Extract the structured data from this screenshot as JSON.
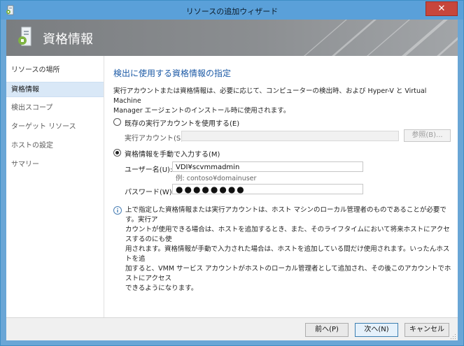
{
  "window": {
    "title": "リソースの追加ウィザード",
    "close_glyph": "✕"
  },
  "header": {
    "title": "資格情報",
    "icon": "server-key-icon"
  },
  "nav": {
    "items": [
      {
        "label": "リソースの場所",
        "state": "normal"
      },
      {
        "label": "資格情報",
        "state": "active"
      },
      {
        "label": "検出スコープ",
        "state": "dim"
      },
      {
        "label": "ターゲット リソース",
        "state": "dim"
      },
      {
        "label": "ホストの設定",
        "state": "dim"
      },
      {
        "label": "サマリー",
        "state": "dim"
      }
    ]
  },
  "main": {
    "section_title": "検出に使用する資格情報の指定",
    "description_line1": "実行アカウントまたは資格情報は、必要に応じて、コンピューターの検出時、および Hyper-V と Virtual Machine",
    "description_line2": "Manager エージェントのインストール時に使用されます。",
    "option_existing": {
      "label": "既存の実行アカウントを使用する(E)",
      "selected": false,
      "field_label": "実行アカウント(S):",
      "field_value": "",
      "browse_label": "参照(B)..."
    },
    "option_manual": {
      "label": "資格情報を手動で入力する(M)",
      "selected": true,
      "username_label": "ユーザー名(U):",
      "username_value": "VDI¥scvmmadmin",
      "username_hint": "例: contoso¥domainuser",
      "password_label": "パスワード(W):",
      "password_value": "●●●●●●●●"
    },
    "info_lines": [
      "上で指定した資格情報または実行アカウントは、ホスト マシンのローカル管理者のものであることが必要です。実行ア",
      "カウントが使用できる場合は、ホストを追加するとき、また、そのライフタイムにおいて将来ホストにアクセスするのにも使",
      "用されます。資格情報が手動で入力された場合は、ホストを追加している間だけ使用されます。いったんホストを追",
      "加すると、VMM サービス アカウントがホストのローカル管理者として追加され、その後このアカウントでホストにアクセス",
      "できるようになります。"
    ]
  },
  "footer": {
    "back_label": "前へ(P)",
    "next_label": "次へ(N)",
    "cancel_label": "キャンセル"
  },
  "colors": {
    "accent": "#1c5aa6",
    "titlebar": "#5aa0d9",
    "close": "#c7463c",
    "nav_active": "#d9e8f7"
  }
}
